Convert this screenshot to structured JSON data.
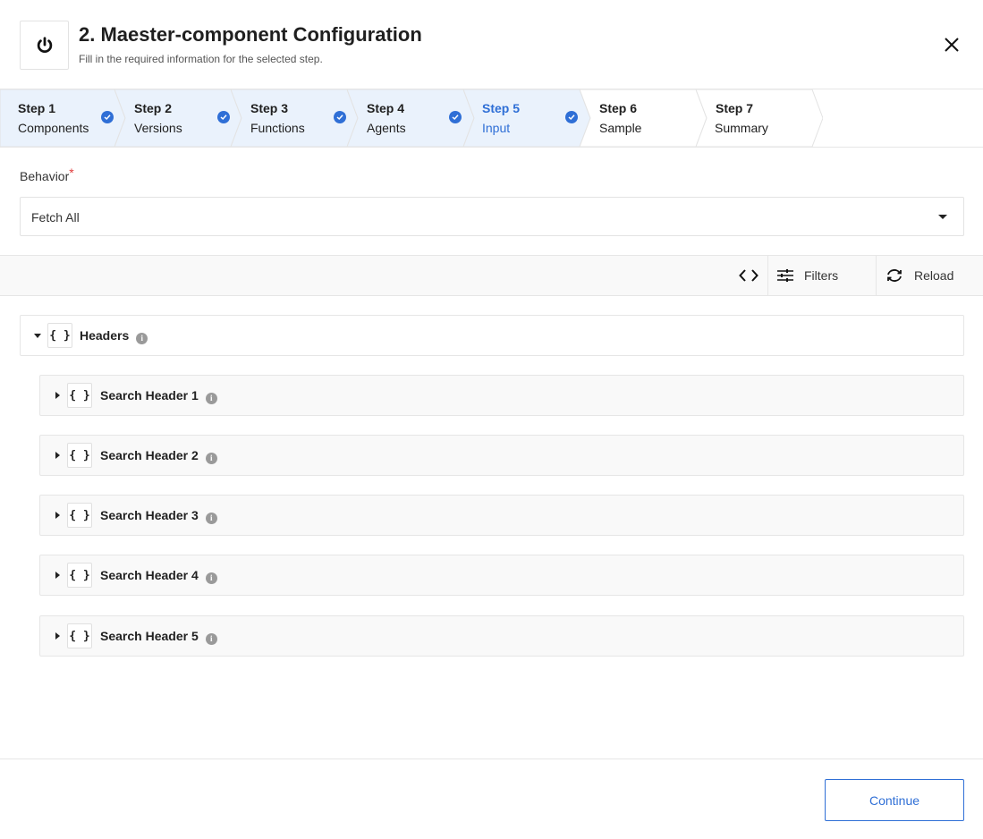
{
  "header": {
    "title": "2. Maester-component Configuration",
    "subtitle": "Fill in the required information for the selected step.",
    "logo_icon": "power-icon",
    "close_icon": "close-icon"
  },
  "steps": [
    {
      "num": "Step 1",
      "label": "Components",
      "state": "completed"
    },
    {
      "num": "Step 2",
      "label": "Versions",
      "state": "completed"
    },
    {
      "num": "Step 3",
      "label": "Functions",
      "state": "completed"
    },
    {
      "num": "Step 4",
      "label": "Agents",
      "state": "completed"
    },
    {
      "num": "Step 5",
      "label": "Input",
      "state": "active-completed"
    },
    {
      "num": "Step 6",
      "label": "Sample",
      "state": "pending"
    },
    {
      "num": "Step 7",
      "label": "Summary",
      "state": "pending"
    }
  ],
  "behavior": {
    "label": "Behavior",
    "required_mark": "*",
    "value": "Fetch All"
  },
  "toolbar": {
    "code_icon": "code-brackets-icon",
    "filters_label": "Filters",
    "reload_label": "Reload"
  },
  "tree": {
    "root": {
      "label": "Headers",
      "expanded": true
    },
    "children": [
      {
        "label": "Search Header 1",
        "expanded": false
      },
      {
        "label": "Search Header 2",
        "expanded": false
      },
      {
        "label": "Search Header 3",
        "expanded": false
      },
      {
        "label": "Search Header 4",
        "expanded": false
      },
      {
        "label": "Search Header 5",
        "expanded": false
      }
    ],
    "object_icon_glyph": "{ }"
  },
  "footer": {
    "continue_label": "Continue"
  },
  "colors": {
    "accent": "#2f6fd6",
    "completed_step_bg": "#eaf2fc",
    "required": "#e03c3c"
  }
}
